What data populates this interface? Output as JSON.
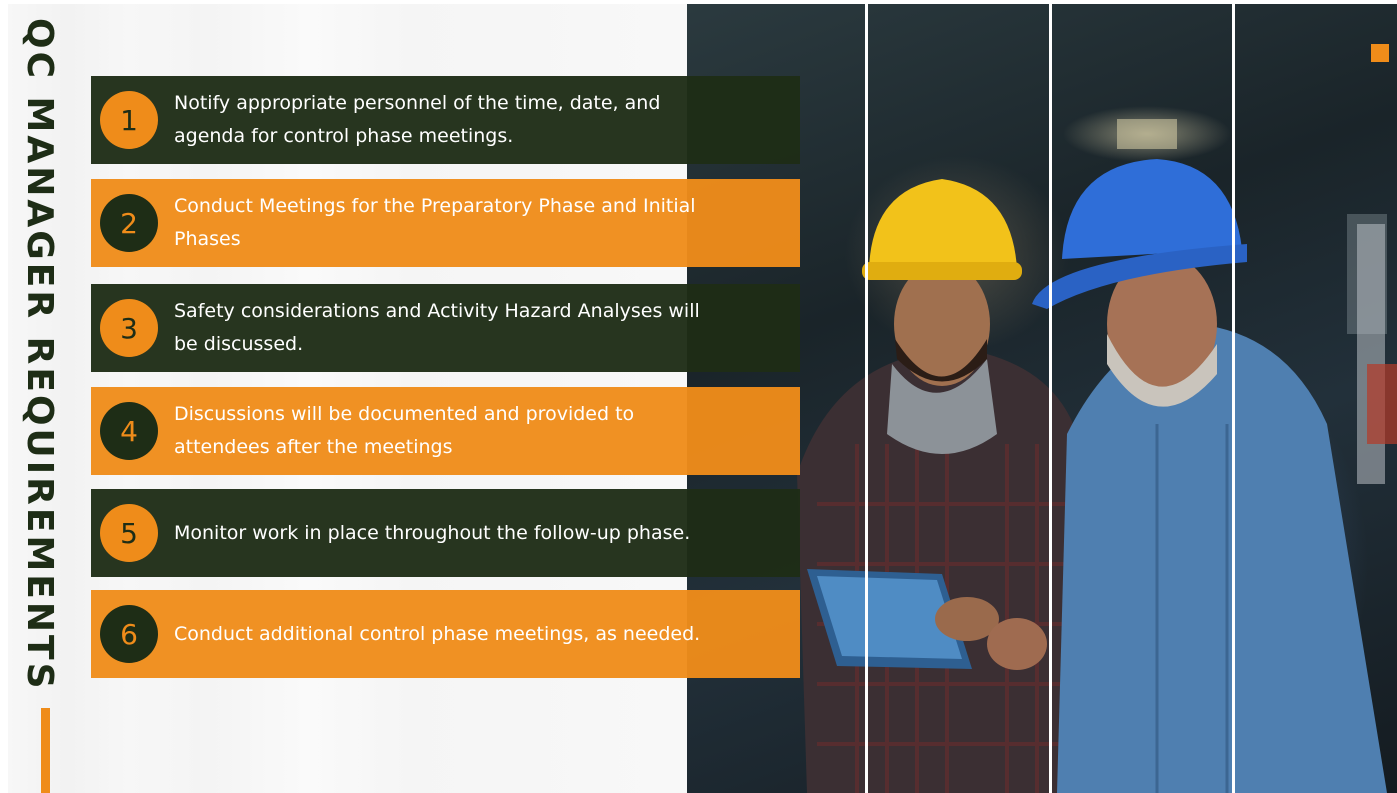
{
  "title": "QC MANAGER REQUIREMENTS",
  "colors": {
    "accent": "#ef8c1a",
    "dark": "#1e2d16"
  },
  "items": [
    {
      "number": "1",
      "text": "Notify appropriate personnel of the time, date, and agenda for control phase meetings.",
      "style": "dark"
    },
    {
      "number": "2",
      "text": "Conduct Meetings for the Preparatory Phase and Initial Phases",
      "style": "orange"
    },
    {
      "number": "3",
      "text": "Safety considerations and Activity Hazard Analyses will be discussed.",
      "style": "dark"
    },
    {
      "number": "4",
      "text": "Discussions will be documented and provided to attendees after the meetings",
      "style": "orange"
    },
    {
      "number": "5",
      "text": "Monitor work in place throughout the follow-up phase.",
      "style": "dark"
    },
    {
      "number": "6",
      "text": "Conduct additional control phase meetings, as needed.",
      "style": "orange"
    }
  ],
  "photo": {
    "description_icon": "construction-workers-photo"
  }
}
